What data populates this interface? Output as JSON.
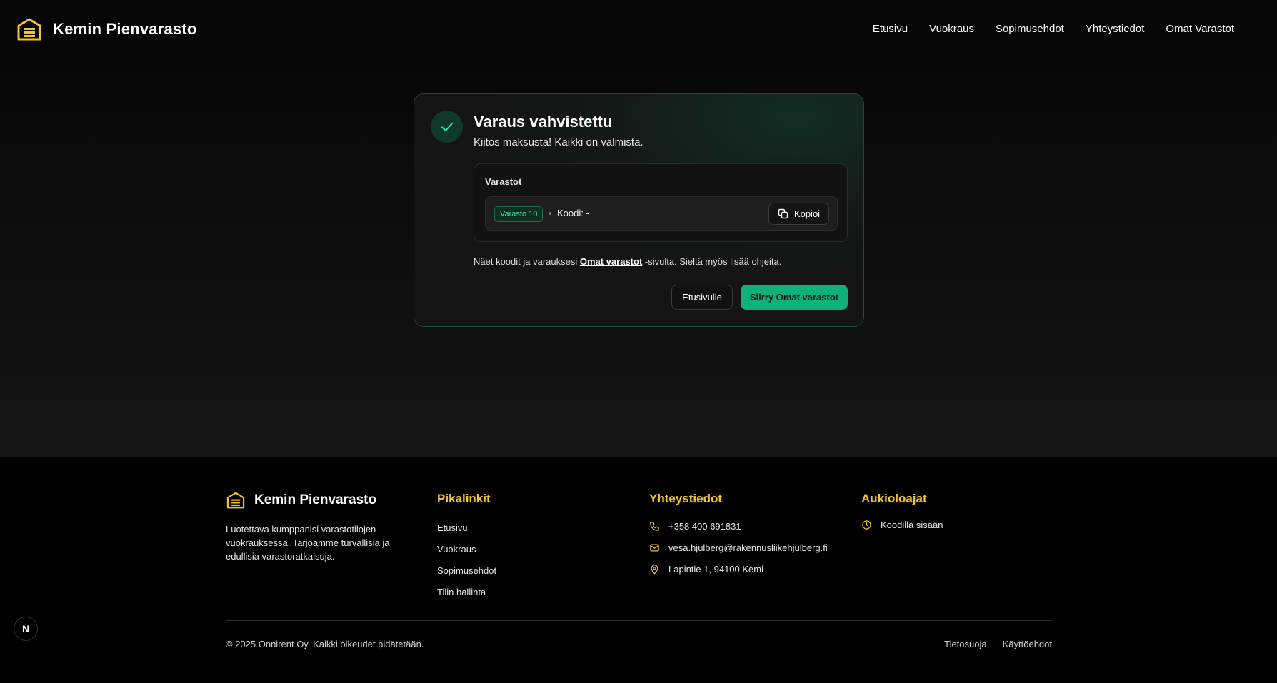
{
  "header": {
    "brand": "Kemin Pienvarasto",
    "nav": [
      "Etusivu",
      "Vuokraus",
      "Sopimusehdot",
      "Yhteystiedot",
      "Omat Varastot"
    ]
  },
  "confirmation": {
    "title": "Varaus vahvistettu",
    "subtitle": "Kiitos maksusta! Kaikki on valmista.",
    "storages_label": "Varastot",
    "storage": {
      "badge": "Varasto 10",
      "code": "Koodi: -"
    },
    "copy_label": "Kopioi",
    "info_prefix": "Näet koodit ja varauksesi ",
    "info_link": "Omat varastot",
    "info_suffix": " -sivulta. Sieltä myös lisää ohjeita.",
    "home_button": "Etusivulle",
    "primary_button": "Siirry Omat varastot"
  },
  "footer": {
    "brand": "Kemin Pienvarasto",
    "description": "Luotettava kumppanisi varastotilojen vuokrauksessa. Tarjoamme turvallisia ja edullisia varastoratkaisuja.",
    "quick_links_title": "Pikalinkit",
    "quick_links": [
      "Etusivu",
      "Vuokraus",
      "Sopimusehdot",
      "Tilin hallinta"
    ],
    "contact_title": "Yhteystiedot",
    "phone": "+358 400 691831",
    "email": "vesa.hjulberg@rakennusliikehjulberg.fi",
    "address": "Lapintie 1, 94100 Kemi",
    "hours_title": "Aukioloajat",
    "hours": "Koodilla sisään",
    "copyright": "© 2025 Onnirent Oy. Kaikki oikeudet pidätetään.",
    "legal": [
      "Tietosuoja",
      "Käyttöehdot"
    ]
  },
  "colors": {
    "accent_green": "#0fb07a",
    "accent_yellow": "#f4c430"
  },
  "icons": [
    "warehouse-icon",
    "check-icon",
    "copy-icon",
    "phone-icon",
    "mail-icon",
    "map-pin-icon",
    "clock-icon"
  ]
}
